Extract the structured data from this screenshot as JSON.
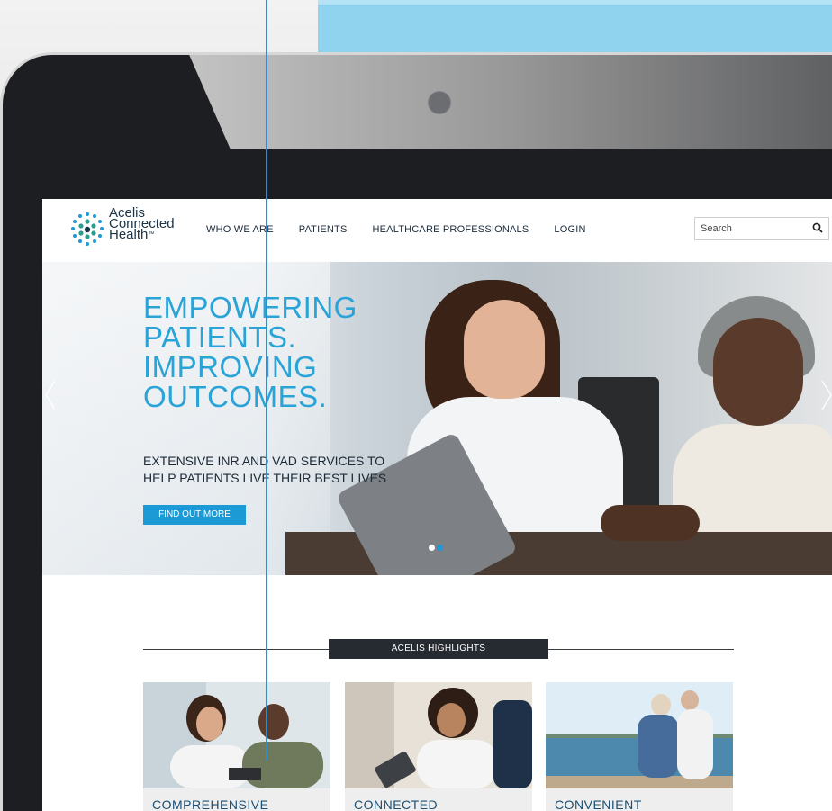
{
  "logo": {
    "line1": "Acelis",
    "line2": "Connected",
    "line3": "Health",
    "tm": "™"
  },
  "nav": {
    "items": [
      {
        "label": "WHO WE ARE"
      },
      {
        "label": "PATIENTS"
      },
      {
        "label": "HEALTHCARE PROFESSIONALS"
      },
      {
        "label": "LOGIN"
      }
    ],
    "search_placeholder": "Search",
    "search_icon": "magnifier"
  },
  "hero": {
    "title_lines": [
      "EMPOWERING",
      "PATIENTS.",
      "IMPROVING",
      "OUTCOMES."
    ],
    "subtitle_lines": [
      "EXTENSIVE INR AND VAD SERVICES TO",
      "HELP PATIENTS LIVE THEIR BEST LIVES"
    ],
    "cta": "FIND OUT MORE",
    "slides": 2,
    "active_slide": 2
  },
  "highlights": {
    "label": "ACELIS HIGHLIGHTS",
    "cards": [
      {
        "caption": "COMPREHENSIVE"
      },
      {
        "caption": "CONNECTED"
      },
      {
        "caption": "CONVENIENT"
      }
    ]
  },
  "colors": {
    "accent": "#1c9ad6",
    "heading": "#2aa3d7",
    "dark": "#262a31",
    "bezel": "#1d1e21",
    "backdrop_blue": "#8fd3ef"
  }
}
